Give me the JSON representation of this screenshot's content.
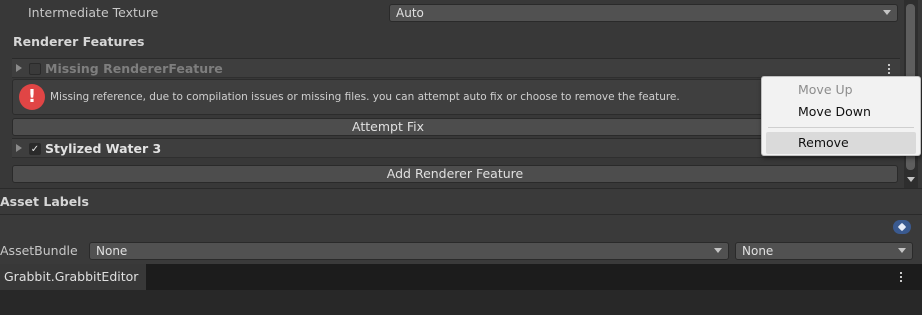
{
  "settings": {
    "intermediate_texture_label": "Intermediate Texture",
    "intermediate_texture_value": "Auto"
  },
  "renderer_features": {
    "header": "Renderer Features",
    "missing_feature": {
      "title": "Missing RendererFeature",
      "enabled": false
    },
    "error_message": "Missing reference, due to compilation issues or missing files. you can attempt auto fix or choose to remove the feature.",
    "attempt_fix_label": "Attempt Fix",
    "stylized_water": {
      "title": "Stylized Water 3",
      "enabled": true,
      "check_glyph": "✓"
    },
    "add_feature_label": "Add Renderer Feature"
  },
  "context_menu": {
    "items": [
      {
        "label": "Move Up",
        "enabled": false
      },
      {
        "label": "Move Down",
        "enabled": true
      },
      {
        "label": "Remove",
        "enabled": true,
        "highlighted": true
      }
    ]
  },
  "asset_labels": {
    "header": "Asset Labels",
    "assetbundle_label": "AssetBundle",
    "bundle_value": "None",
    "variant_value": "None"
  },
  "bottom_tab": {
    "label": "Grabbit.GrabbitEditor"
  },
  "icons": {
    "error": "!",
    "tag": "tag-icon",
    "kebab": "kebab-menu-icon"
  },
  "colors": {
    "background": "#383838",
    "error_red": "#e04545",
    "menu_bg": "#f2f2f2",
    "tag_blue": "#3a5a90"
  }
}
